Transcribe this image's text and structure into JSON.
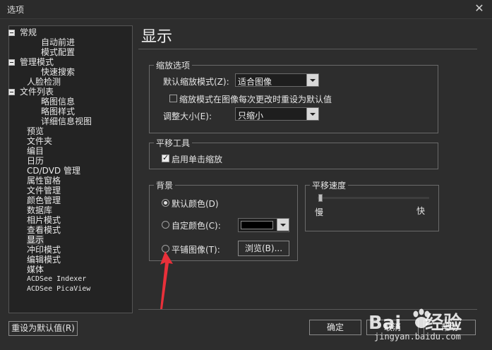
{
  "window": {
    "title": "选项",
    "close_glyph": "✕"
  },
  "tree": [
    {
      "label": "常规",
      "expander": true,
      "indent": 0
    },
    {
      "label": "自动前进",
      "indent": 2
    },
    {
      "label": "模式配置",
      "indent": 2
    },
    {
      "label": "管理模式",
      "expander": true,
      "indent": 0
    },
    {
      "label": "快速搜索",
      "indent": 2
    },
    {
      "label": "人脸检测",
      "indent": 1
    },
    {
      "label": "文件列表",
      "expander": true,
      "indent": 0
    },
    {
      "label": "略图信息",
      "indent": 2
    },
    {
      "label": "略图样式",
      "indent": 2
    },
    {
      "label": "详细信息视图",
      "indent": 2
    },
    {
      "label": "预览",
      "indent": 1
    },
    {
      "label": "文件夹",
      "indent": 1
    },
    {
      "label": "编目",
      "indent": 1
    },
    {
      "label": "日历",
      "indent": 1
    },
    {
      "label": "CD/DVD 管理",
      "indent": 1
    },
    {
      "label": "属性窗格",
      "indent": 1
    },
    {
      "label": "文件管理",
      "indent": 1
    },
    {
      "label": "颜色管理",
      "indent": 1
    },
    {
      "label": "数据库",
      "indent": 1
    },
    {
      "label": "相片模式",
      "indent": 1
    },
    {
      "label": "查看模式",
      "indent": 1
    },
    {
      "label": "显示",
      "indent": 1,
      "selected": true
    },
    {
      "label": "冲印模式",
      "indent": 1
    },
    {
      "label": "编辑模式",
      "indent": 1
    },
    {
      "label": "媒体",
      "indent": 1
    },
    {
      "label": "ACDSee Indexer",
      "indent": 1,
      "mono": true
    },
    {
      "label": "ACDSee PicaView",
      "indent": 1,
      "mono": true
    }
  ],
  "page_title": "显示",
  "zoom": {
    "group_title": "缩放选项",
    "default_label": "默认缩放模式(Z):",
    "default_value": "适合图像",
    "reset_checkbox_label": "缩放模式在图像每次更改时重设为默认值",
    "reset_checked": false,
    "resize_label": "调整大小(E):",
    "resize_value": "只缩小"
  },
  "pan_tool": {
    "group_title": "平移工具",
    "single_click_label": "启用单击缩放",
    "single_click_checked": true
  },
  "background": {
    "group_title": "背景",
    "default_color_label": "默认颜色(D)",
    "custom_color_label": "自定颜色(C):",
    "tile_image_label": "平铺图像(T):",
    "browse_label": "浏览(B)...",
    "selected": "default",
    "custom_color": "#000000"
  },
  "pan_speed": {
    "group_title": "平移速度",
    "slow_label": "慢",
    "fast_label": "快",
    "value_fraction": 0.0
  },
  "buttons": {
    "reset_default": "重设为默认值(R)",
    "ok": "确定",
    "cancel": "取消",
    "help": "帮助"
  },
  "watermark": {
    "brand_left": "Bai",
    "brand_right": "经验",
    "url": "jingyan.baidu.com"
  },
  "colors": {
    "bg": "#2d2d2d",
    "arrow": "#e8303a"
  }
}
